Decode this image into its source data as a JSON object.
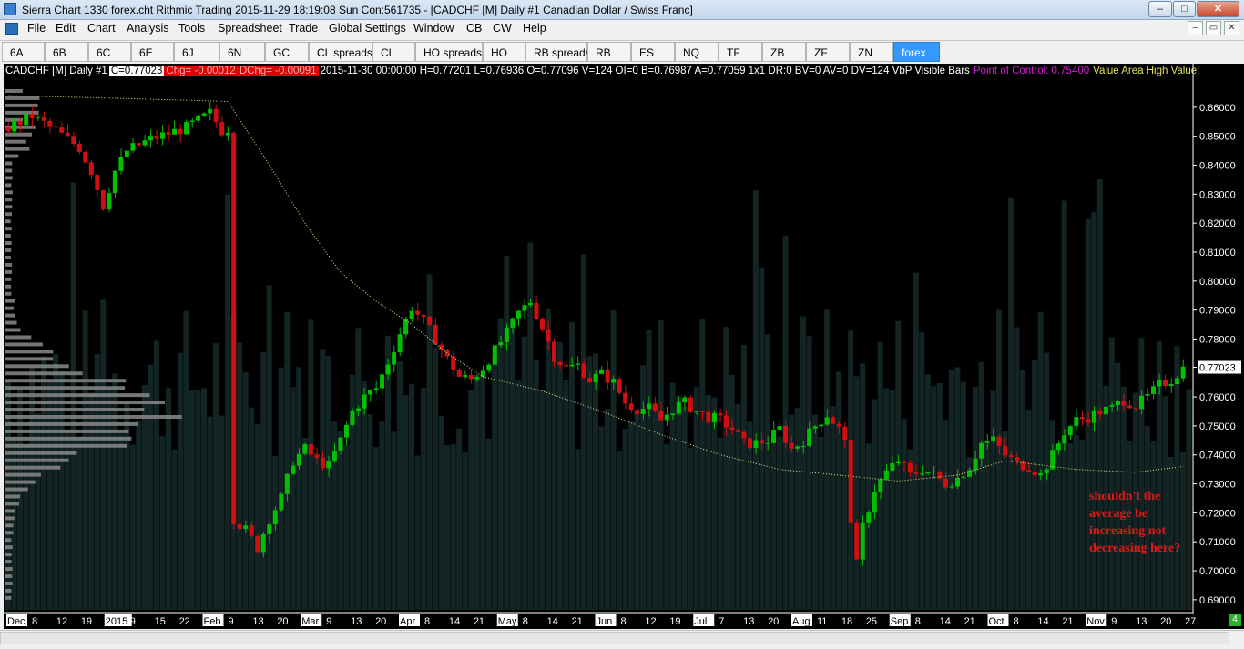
{
  "window": {
    "title": "Sierra Chart 1330 forex.cht  Rithmic Trading 2015-11-29  18:19:08 Sun  Con:561735 - [CADCHF [M]  Daily  #1  Canadian Dollar / Swiss Franc]",
    "minimize_label": "–",
    "maximize_label": "□",
    "close_label": "✕"
  },
  "menu": [
    "File",
    "Edit",
    "Chart",
    "Analysis",
    "Tools",
    "Spreadsheet",
    "Trade",
    "Global Settings",
    "Window",
    "CB",
    "CW",
    "Help"
  ],
  "mdi_buttons": [
    "–",
    "▭",
    "✕"
  ],
  "tabs": [
    {
      "label": "6A",
      "active": false
    },
    {
      "label": "6B",
      "active": false
    },
    {
      "label": "6C",
      "active": false
    },
    {
      "label": "6E",
      "active": false
    },
    {
      "label": "6J",
      "active": false
    },
    {
      "label": "6N",
      "active": false
    },
    {
      "label": "GC",
      "active": false
    },
    {
      "label": "CL spreads",
      "active": false
    },
    {
      "label": "CL",
      "active": false
    },
    {
      "label": "HO spreads",
      "active": false
    },
    {
      "label": "HO",
      "active": false
    },
    {
      "label": "RB spreads",
      "active": false
    },
    {
      "label": "RB",
      "active": false
    },
    {
      "label": "ES",
      "active": false
    },
    {
      "label": "NQ",
      "active": false
    },
    {
      "label": "TF",
      "active": false
    },
    {
      "label": "ZB",
      "active": false
    },
    {
      "label": "ZF",
      "active": false
    },
    {
      "label": "ZN",
      "active": false
    },
    {
      "label": "forex",
      "active": true
    }
  ],
  "infobar": {
    "symbol": "CADCHF [M]  Daily  #1",
    "close": "C=0.77023",
    "chg": "Chg= -0.00012",
    "dchg": "DChg= -0.00091",
    "details": "2015-11-30 00:00:00 H=0.77201 L=0.76936 O=0.77096 V=124 OI=0 B=0.76987 A=0.77059 1x1 DR:0 BV=0 AV=0 DV=124  VbP Visible Bars",
    "poc": "Point of Control: 0.75400",
    "va": "Value Area High Value:"
  },
  "annotation": "shouldn't the average be increasing not decreasing here?",
  "colors": {
    "background": "#000000",
    "up_candle": "#00c000",
    "down_candle": "#d01010",
    "volume_bars": "#132424",
    "profile": "#8a8a8a",
    "moving_average": "#e8e880",
    "price_label": "#ffffff",
    "annotation": "#e01818"
  },
  "chart_data": {
    "type": "candlestick",
    "symbol": "CADCHF",
    "price_axis_labels": [
      "0.86000",
      "0.85000",
      "0.84000",
      "0.83000",
      "0.82000",
      "0.81000",
      "0.80000",
      "0.79000",
      "0.78000",
      "0.77023",
      "0.76000",
      "0.75000",
      "0.74000",
      "0.73000",
      "0.72000",
      "0.71000",
      "0.70000",
      "0.69000"
    ],
    "ylim": [
      0.6865,
      0.8675
    ],
    "current_price": "0.77023",
    "point_of_control": 0.754,
    "time_axis_labels": [
      "Dec",
      "8",
      "12",
      "19",
      "2015",
      "9",
      "15",
      "22",
      "Feb",
      "9",
      "13",
      "20",
      "Mar",
      "9",
      "13",
      "20",
      "Apr",
      "8",
      "14",
      "21",
      "May",
      "8",
      "14",
      "21",
      "Jun",
      "8",
      "12",
      "19",
      "Jul",
      "7",
      "13",
      "20",
      "Aug",
      "11",
      "18",
      "25",
      "Sep",
      "8",
      "14",
      "21",
      "Oct",
      "8",
      "14",
      "21",
      "Nov",
      "9",
      "13",
      "20",
      "27"
    ],
    "highlighted_time_labels": [
      "Dec",
      "2015",
      "Feb",
      "Mar",
      "Apr",
      "May",
      "Jun",
      "Jul",
      "Aug",
      "Sep",
      "Oct",
      "Nov"
    ],
    "close_path": [
      [
        0,
        0.853
      ],
      [
        4,
        0.857
      ],
      [
        8,
        0.852
      ],
      [
        12,
        0.846
      ],
      [
        14,
        0.838
      ],
      [
        16,
        0.826
      ],
      [
        18,
        0.838
      ],
      [
        20,
        0.845
      ],
      [
        24,
        0.849
      ],
      [
        30,
        0.853
      ],
      [
        34,
        0.858
      ],
      [
        36,
        0.852
      ],
      [
        37.5,
        0.853
      ],
      [
        38,
        0.718
      ],
      [
        40,
        0.714
      ],
      [
        42,
        0.708
      ],
      [
        44,
        0.718
      ],
      [
        46,
        0.725
      ],
      [
        48,
        0.738
      ],
      [
        50,
        0.742
      ],
      [
        52,
        0.738
      ],
      [
        54,
        0.736
      ],
      [
        56,
        0.745
      ],
      [
        58,
        0.755
      ],
      [
        60,
        0.76
      ],
      [
        62,
        0.763
      ],
      [
        64,
        0.772
      ],
      [
        66,
        0.782
      ],
      [
        68,
        0.791
      ],
      [
        70,
        0.786
      ],
      [
        72,
        0.78
      ],
      [
        74,
        0.773
      ],
      [
        76,
        0.767
      ],
      [
        78,
        0.766
      ],
      [
        80,
        0.77
      ],
      [
        82,
        0.776
      ],
      [
        84,
        0.782
      ],
      [
        86,
        0.789
      ],
      [
        88,
        0.793
      ],
      [
        90,
        0.784
      ],
      [
        92,
        0.774
      ],
      [
        94,
        0.77
      ],
      [
        96,
        0.771
      ],
      [
        98,
        0.766
      ],
      [
        100,
        0.768
      ],
      [
        102,
        0.765
      ],
      [
        104,
        0.758
      ],
      [
        106,
        0.756
      ],
      [
        108,
        0.756
      ],
      [
        110,
        0.752
      ],
      [
        112,
        0.756
      ],
      [
        114,
        0.758
      ],
      [
        116,
        0.755
      ],
      [
        118,
        0.753
      ],
      [
        120,
        0.752
      ],
      [
        122,
        0.749
      ],
      [
        124,
        0.744
      ],
      [
        126,
        0.744
      ],
      [
        128,
        0.745
      ],
      [
        130,
        0.749
      ],
      [
        132,
        0.742
      ],
      [
        134,
        0.745
      ],
      [
        136,
        0.75
      ],
      [
        138,
        0.754
      ],
      [
        140,
        0.749
      ],
      [
        141,
        0.744
      ],
      [
        142,
        0.718
      ],
      [
        143,
        0.702
      ],
      [
        144,
        0.715
      ],
      [
        146,
        0.728
      ],
      [
        148,
        0.734
      ],
      [
        150,
        0.738
      ],
      [
        152,
        0.733
      ],
      [
        154,
        0.735
      ],
      [
        156,
        0.733
      ],
      [
        158,
        0.73
      ],
      [
        160,
        0.732
      ],
      [
        162,
        0.736
      ],
      [
        164,
        0.744
      ],
      [
        166,
        0.745
      ],
      [
        168,
        0.74
      ],
      [
        170,
        0.737
      ],
      [
        172,
        0.736
      ],
      [
        174,
        0.733
      ],
      [
        176,
        0.74
      ],
      [
        178,
        0.748
      ],
      [
        180,
        0.752
      ],
      [
        182,
        0.753
      ],
      [
        184,
        0.755
      ],
      [
        186,
        0.756
      ],
      [
        188,
        0.759
      ],
      [
        190,
        0.757
      ],
      [
        192,
        0.76
      ],
      [
        194,
        0.764
      ],
      [
        196,
        0.766
      ],
      [
        198,
        0.77
      ]
    ],
    "moving_average_path": [
      [
        0,
        0.864
      ],
      [
        20,
        0.863
      ],
      [
        37,
        0.862
      ],
      [
        44,
        0.84
      ],
      [
        50,
        0.82
      ],
      [
        56,
        0.803
      ],
      [
        62,
        0.793
      ],
      [
        68,
        0.785
      ],
      [
        74,
        0.775
      ],
      [
        80,
        0.767
      ],
      [
        90,
        0.762
      ],
      [
        100,
        0.755
      ],
      [
        110,
        0.747
      ],
      [
        120,
        0.74
      ],
      [
        130,
        0.735
      ],
      [
        140,
        0.733
      ],
      [
        150,
        0.731
      ],
      [
        160,
        0.733
      ],
      [
        168,
        0.738
      ],
      [
        172,
        0.737
      ],
      [
        180,
        0.735
      ],
      [
        190,
        0.734
      ],
      [
        198,
        0.736
      ]
    ]
  }
}
